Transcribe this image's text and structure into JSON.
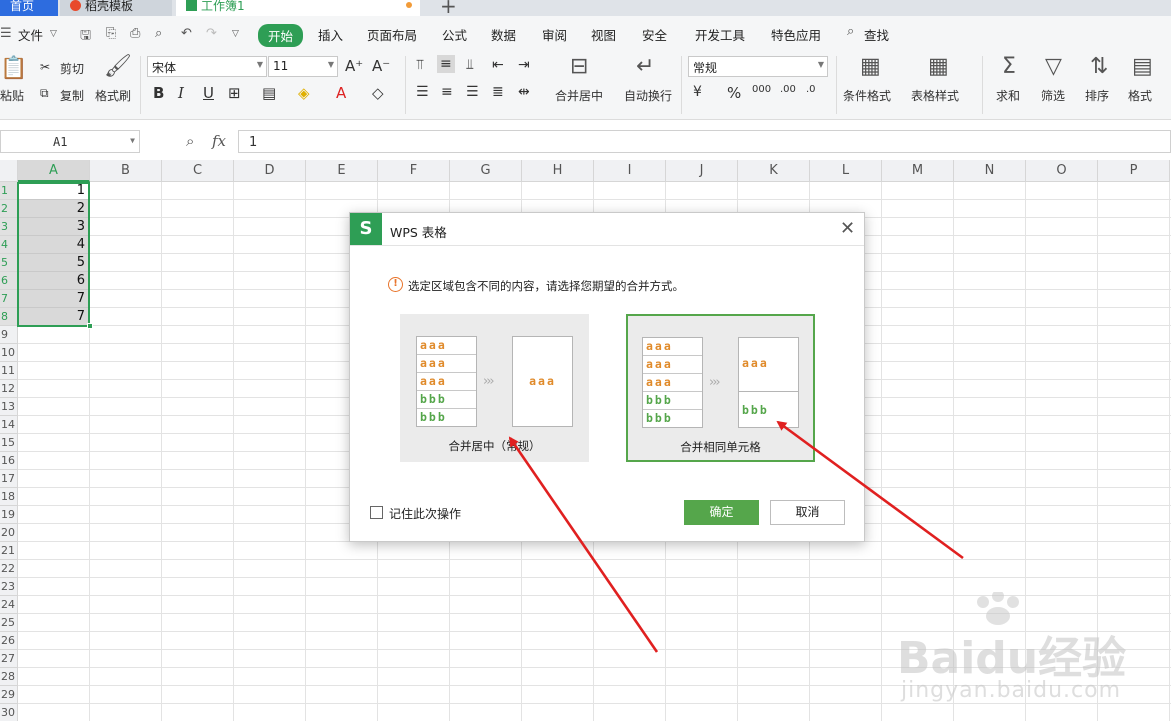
{
  "tabs": {
    "home": "首页",
    "template": "稻壳模板",
    "workbook": "工作簿1",
    "plus": "+"
  },
  "menu": {
    "file": "文件",
    "start": "开始",
    "insert": "插入",
    "layout": "页面布局",
    "formula": "公式",
    "data": "数据",
    "review": "审阅",
    "view": "视图",
    "security": "安全",
    "developer": "开发工具",
    "special": "特色应用",
    "search": "查找"
  },
  "ribbon": {
    "paste": "粘贴",
    "cut": "剪切",
    "copy": "复制",
    "format_painter": "格式刷",
    "font_name": "宋体",
    "font_size": "11",
    "bold": "B",
    "italic": "I",
    "underline": "U",
    "merge_center": "合并居中",
    "wrap_text": "自动换行",
    "number_format": "常规",
    "cond_format": "条件格式",
    "table_style": "表格样式",
    "sum": "求和",
    "filter": "筛选",
    "sort": "排序",
    "format": "格式"
  },
  "formula_bar": {
    "name_box": "A1",
    "fx": "fx",
    "value": "1"
  },
  "grid": {
    "columns": [
      "A",
      "B",
      "C",
      "D",
      "E",
      "F",
      "G",
      "H",
      "I",
      "J",
      "K",
      "L",
      "M",
      "N",
      "O",
      "P"
    ],
    "rows": [
      "1",
      "2",
      "3",
      "4",
      "5",
      "6",
      "7",
      "8",
      "9",
      "10",
      "11",
      "12",
      "13",
      "14",
      "15",
      "16",
      "17",
      "18",
      "19",
      "20",
      "21",
      "22",
      "23",
      "24",
      "25",
      "26",
      "27",
      "28",
      "29",
      "30"
    ],
    "column_a_values": [
      "1",
      "2",
      "3",
      "4",
      "5",
      "6",
      "7",
      "7"
    ]
  },
  "dialog": {
    "title": "WPS 表格",
    "message": "选定区域包含不同的内容，请选择您期望的合并方式。",
    "warn_glyph": "!",
    "sample_a": "aaa",
    "sample_b": "bbb",
    "option_center": "合并居中（常规）",
    "option_same": "合并相同单元格",
    "remember": "记住此次操作",
    "ok": "确定",
    "cancel": "取消"
  },
  "watermark": {
    "brand": "Baidu经验",
    "url": "jingyan.baidu.com"
  },
  "colors": {
    "accent_green": "#2e9e55",
    "dialog_green": "#55a64b",
    "annotation_red": "#e02020",
    "sample_orange": "#e08a2a"
  }
}
